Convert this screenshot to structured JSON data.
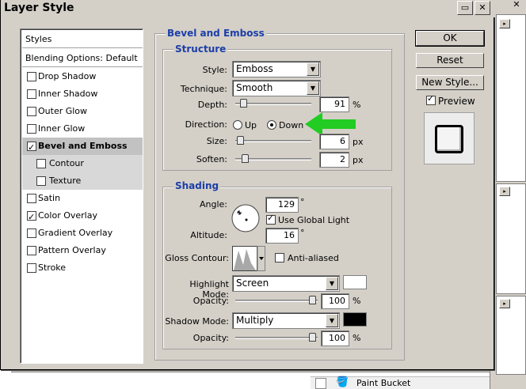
{
  "dialog": {
    "title": "Layer Style",
    "buttons": {
      "ok": "OK",
      "reset": "Reset",
      "new_style": "New Style...",
      "preview_label": "Preview"
    }
  },
  "styles_list": {
    "header": "Styles",
    "blending": "Blending Options: Default",
    "items": [
      {
        "label": "Drop Shadow",
        "checked": false
      },
      {
        "label": "Inner Shadow",
        "checked": false
      },
      {
        "label": "Outer Glow",
        "checked": false
      },
      {
        "label": "Inner Glow",
        "checked": false
      },
      {
        "label": "Bevel and Emboss",
        "checked": true
      },
      {
        "label": "Contour",
        "checked": false
      },
      {
        "label": "Texture",
        "checked": false
      },
      {
        "label": "Satin",
        "checked": false
      },
      {
        "label": "Color Overlay",
        "checked": true
      },
      {
        "label": "Gradient Overlay",
        "checked": false
      },
      {
        "label": "Pattern Overlay",
        "checked": false
      },
      {
        "label": "Stroke",
        "checked": false
      }
    ]
  },
  "bevel": {
    "title": "Bevel and Emboss",
    "structure": {
      "title": "Structure",
      "style_label": "Style:",
      "style_value": "Emboss",
      "technique_label": "Technique:",
      "technique_value": "Smooth",
      "depth_label": "Depth:",
      "depth_value": "91",
      "depth_unit": "%",
      "direction_label": "Direction:",
      "up_label": "Up",
      "down_label": "Down",
      "size_label": "Size:",
      "size_value": "6",
      "size_unit": "px",
      "soften_label": "Soften:",
      "soften_value": "2",
      "soften_unit": "px"
    },
    "shading": {
      "title": "Shading",
      "angle_label": "Angle:",
      "angle_value": "129",
      "angle_unit": "°",
      "global_light_label": "Use Global Light",
      "altitude_label": "Altitude:",
      "altitude_value": "16",
      "altitude_unit": "°",
      "gloss_label": "Gloss Contour:",
      "anti_aliased_label": "Anti-aliased",
      "highlight_mode_label": "Highlight Mode:",
      "highlight_mode_value": "Screen",
      "highlight_opacity_label": "Opacity:",
      "highlight_opacity_value": "100",
      "highlight_opacity_unit": "%",
      "shadow_mode_label": "Shadow Mode:",
      "shadow_mode_value": "Multiply",
      "shadow_opacity_label": "Opacity:",
      "shadow_opacity_value": "100",
      "shadow_opacity_unit": "%"
    }
  },
  "background": {
    "paint_bucket_label": "Paint Bucket"
  },
  "colors": {
    "annotation_arrow": "#22cc22",
    "section_title": "#1c3ea8",
    "highlight_color": "#ffffff",
    "shadow_color": "#000000"
  }
}
